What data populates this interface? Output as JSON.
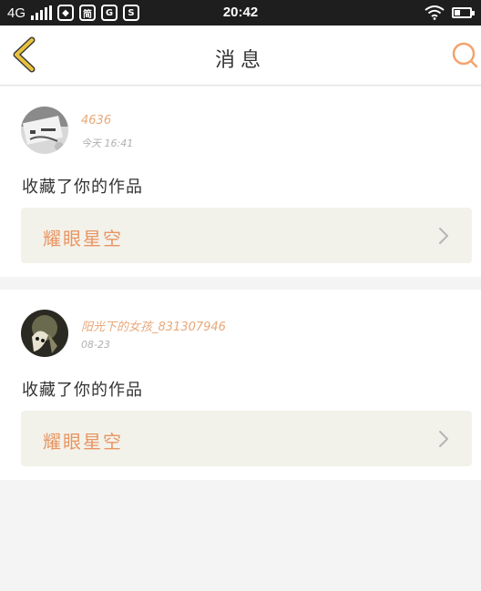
{
  "status_bar": {
    "network": "4G",
    "app_icons": [
      "简",
      "G",
      "S"
    ],
    "time": "20:42"
  },
  "header": {
    "title": "消息",
    "back_icon": "chevron-left-icon",
    "search_icon": "search-icon"
  },
  "messages": [
    {
      "username": "4636",
      "time": "今天 16:41",
      "action": "收藏了你的作品",
      "work_title": "耀眼星空"
    },
    {
      "username": "阳光下的女孩_831307946",
      "time": "08-23",
      "action": "收藏了你的作品",
      "work_title": "耀眼星空"
    }
  ],
  "colors": {
    "accent_yellow": "#e8c23c",
    "accent_orange": "#f2a36c",
    "username": "#e8a87a",
    "work_title": "#e89563",
    "card_link_bg": "#f3f2ea"
  }
}
